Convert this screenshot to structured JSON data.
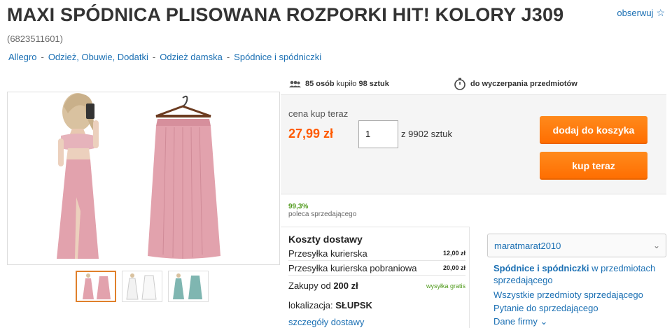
{
  "title": "MAXI SPÓDNICA PLISOWANA ROZPORKI HIT! KOLORY J309",
  "watch": {
    "label": "obserwuj"
  },
  "item_id": "(6823511601)",
  "breadcrumb": [
    "Allegro",
    "Odzież, Obuwie, Dodatki",
    "Odzież damska",
    "Spódnice i spódniczki"
  ],
  "breadcrumb_sep": "-",
  "stats": {
    "buyers": "85 osób",
    "bought_text": "kupiło",
    "units": "98 sztuk",
    "until": "do wyczerpania przedmiotów"
  },
  "buy": {
    "price_label": "cena kup teraz",
    "price": "27,99 zł",
    "quantity": "1",
    "of_total": "z 9902 sztuk",
    "add_to_cart": "dodaj do koszyka",
    "buy_now": "kup teraz"
  },
  "rating": {
    "percent": "99,3%",
    "label": "poleca sprzedającego"
  },
  "shipping": {
    "title": "Koszty dostawy",
    "rows": [
      {
        "name": "Przesyłka kurierska",
        "price": "12,00 zł"
      },
      {
        "name": "Przesyłka kurierska pobraniowa",
        "price": "20,00 zł"
      }
    ],
    "free_text_prefix": "Zakupy od",
    "free_amount": "200 zł",
    "free_label": "wysyłka gratis",
    "location_label": "lokalizacja:",
    "location": "SŁUPSK",
    "details_link": "szczegóły dostawy"
  },
  "seller": {
    "name": "maratmarat2010",
    "category_bold": "Spódnice i spódniczki",
    "category_rest": " w przedmiotach sprzedającego",
    "all_items": "Wszystkie przedmioty sprzedającego",
    "ask": "Pytanie do sprzedającego",
    "company": "Dane firmy"
  },
  "colors": {
    "accent_orange": "#ff6d00",
    "price_orange": "#ff5a00",
    "link_blue": "#1a6fb3",
    "rating_green": "#4f9a1b",
    "skirt_pink": "#e2a2ad",
    "skirt_teal": "#7fb6b1"
  },
  "thumbnails": [
    {
      "icon": "pink-skirt-model-thumb",
      "active": true
    },
    {
      "icon": "white-skirt-thumb",
      "active": false
    },
    {
      "icon": "teal-skirt-thumb",
      "active": false
    }
  ]
}
